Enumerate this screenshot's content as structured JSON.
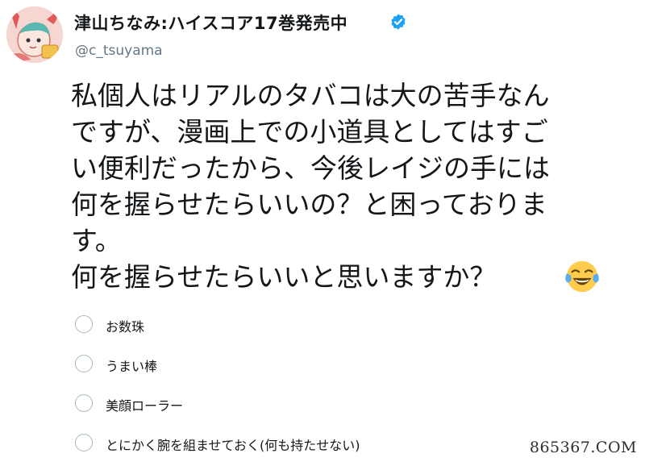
{
  "user": {
    "display_name": "津山ちなみ:ハイスコア17巻発売中",
    "handle": "@c_tsuyama",
    "avatar_icon": "user-avatar-illustration",
    "verified_icon": "verified-badge-icon"
  },
  "tweet": {
    "lines": [
      "私個人はリアルのタバコは大の苦手なん",
      "ですが、漫画上での小道具としてはすご",
      "い便利だったから、今後レイジの手には",
      "何を握らせたらいいの？と困っておりま",
      "す。",
      "何を握らせたらいいと思いますか？"
    ],
    "emoji_icon": "face-with-tears-of-joy-emoji"
  },
  "poll": {
    "options": [
      "お数珠",
      "うまい棒",
      "美顔ローラー",
      "とにかく腕を組ませておく(何も持たせない)"
    ]
  },
  "watermark": "865367.COM",
  "colors": {
    "verified_blue": "#1da1f2",
    "secondary_text": "#657786",
    "radio_border": "#aab8c2"
  }
}
